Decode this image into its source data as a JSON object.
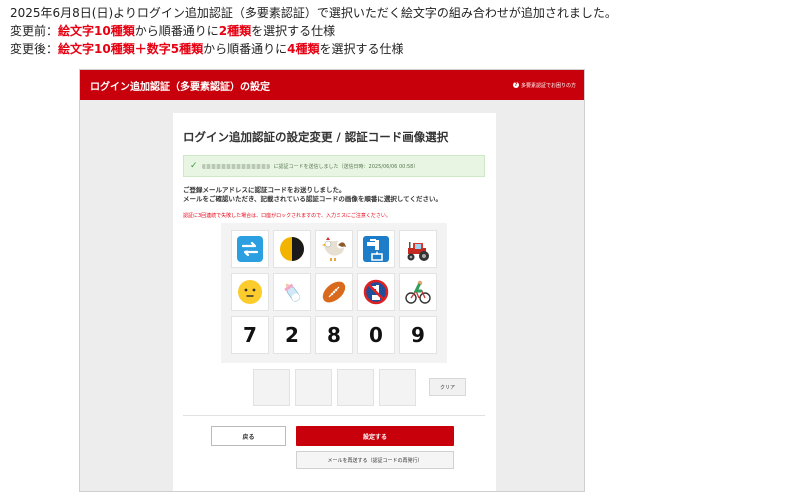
{
  "intro": {
    "line1": "2025年6月8日(日)よりログイン追加認証（多要素認証）で選択いただく絵文字の組み合わせが追加されました。",
    "before_label": "変更前：",
    "before_red1": "絵文字10種類",
    "before_text1": "から順番通りに",
    "before_red2": "2種類",
    "before_text2": "を選択する仕様",
    "after_label": "変更後：",
    "after_red1": "絵文字10種類＋数字5種類",
    "after_text1": "から順番通りに",
    "after_red2": "4種類",
    "after_text2": "を選択する仕様"
  },
  "topbar": {
    "title": "ログイン追加認証（多要素認証）の設定",
    "help": "多要素認証でお困りの方",
    "help_icon": "?"
  },
  "card": {
    "title": "ログイン追加認証の設定変更 / 認証コード画像選択",
    "notice_check": "✓",
    "notice_text": "に認証コードを送信しました（送信日時：2025/06/06 00:58）",
    "message_line1": "ご登録メールアドレスに認証コードをお送りしました。",
    "message_line2": "メールをご確認いただき、記載されている認証コードの画像を順番に選択してください。",
    "warning": "認証に3回連続で失敗した場合は、口座がロックされますので、入力ミスにご注意ください。"
  },
  "tiles": {
    "row1": [
      "repeat-icon",
      "half-circle-icon",
      "rooster-icon",
      "water-tap-icon",
      "tractor-icon"
    ],
    "row2": [
      "smiley-face-icon",
      "baby-bottle-icon",
      "rugby-ball-icon",
      "no-drinking-water-icon",
      "cyclist-icon"
    ],
    "numbers": [
      "7",
      "2",
      "8",
      "0",
      "9"
    ]
  },
  "buttons": {
    "clear": "クリア",
    "back": "戻る",
    "submit": "設定する",
    "resend": "メールを再送する（認証コードの再発行）"
  },
  "colors": {
    "brand_red": "#c8000b",
    "highlight_red": "#e60012",
    "notice_green": "#e8f5e3"
  }
}
